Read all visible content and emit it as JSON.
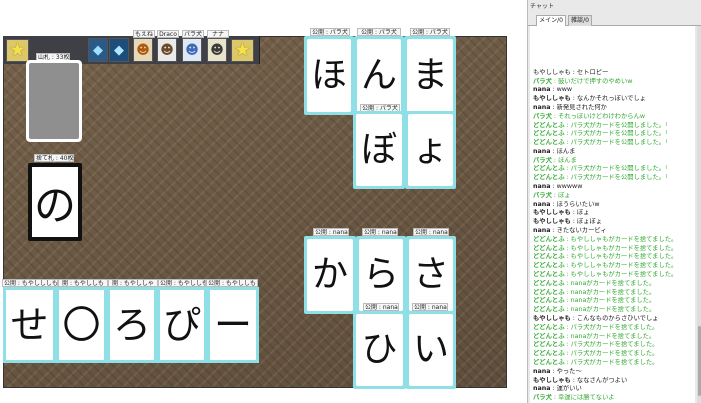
{
  "colors": {
    "board": "#6d5a45",
    "card_border": "#8ee0e6",
    "chat_green": "#33aa33",
    "chat_name": "#222222"
  },
  "tokens": [
    {
      "label": "",
      "icon": "star-icon"
    },
    {
      "label": "",
      "icon": "crystal-icon"
    },
    {
      "label": "",
      "icon": "crystal-icon"
    },
    {
      "label": "もえね",
      "icon": "character-icon"
    },
    {
      "label": "Draco",
      "icon": "character-icon"
    },
    {
      "label": "パラ犬",
      "icon": "character-icon"
    },
    {
      "label": "ナナ",
      "icon": "character-icon"
    },
    {
      "label": "",
      "icon": "star-icon"
    }
  ],
  "deck": {
    "label": "山札 : 33枚"
  },
  "discard": {
    "label": "捨て札 : 40枚",
    "char": "の"
  },
  "public_top": {
    "labels": [
      "公開 : パラ犬",
      "公開 : パラ犬",
      "公開 : パラ犬",
      "公開 : パラ犬"
    ],
    "chars": [
      "ほ",
      "ん",
      "ま",
      "ぼ",
      "ょ"
    ]
  },
  "public_mid": {
    "labels": [
      "公開 : nana",
      "公開 : nana",
      "公開 : nana",
      "公開 : nana",
      "公開 : nana"
    ],
    "chars": [
      "か",
      "ら",
      "さ",
      "ひ",
      "い"
    ]
  },
  "hand": {
    "labels": [
      "公開 : もやしししも",
      "開 : もやししも",
      "開 : もやししゃ",
      "公開 : もやししも",
      "公開 : もやししも"
    ],
    "chars": [
      "せ",
      "〇",
      "ろ",
      "ぴ",
      "ー"
    ]
  },
  "chat": {
    "title": "チャット",
    "tabs": [
      "メイン/0",
      "雑談/0"
    ],
    "lines": [
      {
        "name": "",
        "text": "もやししゃも : セトロピー",
        "kind": "normal"
      },
      {
        "name": "パラ犬",
        "text": " : 鼓いだけで押すのやめいw",
        "kind": "green"
      },
      {
        "name": "nana",
        "text": " : www",
        "kind": "normal"
      },
      {
        "name": "もやししゃも",
        "text": " : なんかそれっぽいでしょ",
        "kind": "normal"
      },
      {
        "name": "nana",
        "text": " : 新発見された何か",
        "kind": "normal"
      },
      {
        "name": "パラ犬",
        "text": " : それっぽいけどわけわからんw",
        "kind": "green"
      },
      {
        "name": "どどんとふ",
        "text": " : パラ犬がカードを公開しました。「",
        "kind": "green"
      },
      {
        "name": "どどんとふ",
        "text": " : パラ犬がカードを公開しました。「",
        "kind": "green"
      },
      {
        "name": "どどんとふ",
        "text": " : パラ犬がカードを公開しました。「",
        "kind": "green"
      },
      {
        "name": "nana",
        "text": " : ほんま",
        "kind": "normal"
      },
      {
        "name": "パラ犬",
        "text": " : ほんま",
        "kind": "green"
      },
      {
        "name": "どどんとふ",
        "text": " : パラ犬がカードを公開しました。「",
        "kind": "green"
      },
      {
        "name": "どどんとふ",
        "text": " : パラ犬がカードを公開しました。「",
        "kind": "green"
      },
      {
        "name": "nana",
        "text": " : wwwww",
        "kind": "normal"
      },
      {
        "name": "パラ犬",
        "text": " : ぼょ",
        "kind": "green"
      },
      {
        "name": "nana",
        "text": " : ほうらいたいw",
        "kind": "normal"
      },
      {
        "name": "もやししゃも",
        "text": " : ぼょ",
        "kind": "normal"
      },
      {
        "name": "もやししゃも",
        "text": " : ぼょぼょ",
        "kind": "normal"
      },
      {
        "name": "nana",
        "text": " : きたないカービィ",
        "kind": "normal"
      },
      {
        "name": "どどんとふ",
        "text": " : もやししゃもがカードを捨てました。",
        "kind": "green"
      },
      {
        "name": "どどんとふ",
        "text": " : もやししゃもがカードを捨てました。",
        "kind": "green"
      },
      {
        "name": "どどんとふ",
        "text": " : もやししゃもがカードを捨てました。",
        "kind": "green"
      },
      {
        "name": "どどんとふ",
        "text": " : もやししゃもがカードを捨てました。",
        "kind": "green"
      },
      {
        "name": "どどんとふ",
        "text": " : もやししゃもがカードを捨てました。",
        "kind": "green"
      },
      {
        "name": "どどんとふ",
        "text": " : nanaがカードを捨てました。",
        "kind": "green"
      },
      {
        "name": "どどんとふ",
        "text": " : nanaがカードを捨てました。",
        "kind": "green"
      },
      {
        "name": "どどんとふ",
        "text": " : nanaがカードを捨てました。",
        "kind": "green"
      },
      {
        "name": "どどんとふ",
        "text": " : nanaがカードを捨てました。",
        "kind": "green"
      },
      {
        "name": "もやししゃも",
        "text": " : こんなものからさひいでしょ",
        "kind": "normal"
      },
      {
        "name": "どどんとふ",
        "text": " : パラ犬がカードを捨てました。",
        "kind": "green"
      },
      {
        "name": "どどんとふ",
        "text": " : nanaがカードを捨てました。",
        "kind": "green"
      },
      {
        "name": "どどんとふ",
        "text": " : パラ犬がカードを捨てました。",
        "kind": "green"
      },
      {
        "name": "どどんとふ",
        "text": " : パラ犬がカードを捨てました。",
        "kind": "green"
      },
      {
        "name": "どどんとふ",
        "text": " : パラ犬がカードを捨てました。",
        "kind": "green"
      },
      {
        "name": "nana",
        "text": " : やった〜",
        "kind": "normal"
      },
      {
        "name": "もやししゃも",
        "text": " : ななさんがつよい",
        "kind": "normal"
      },
      {
        "name": "nana",
        "text": " : 運がいい",
        "kind": "normal"
      },
      {
        "name": "パラ犬",
        "text": " : 幸運には勝てないよ",
        "kind": "green"
      }
    ]
  }
}
